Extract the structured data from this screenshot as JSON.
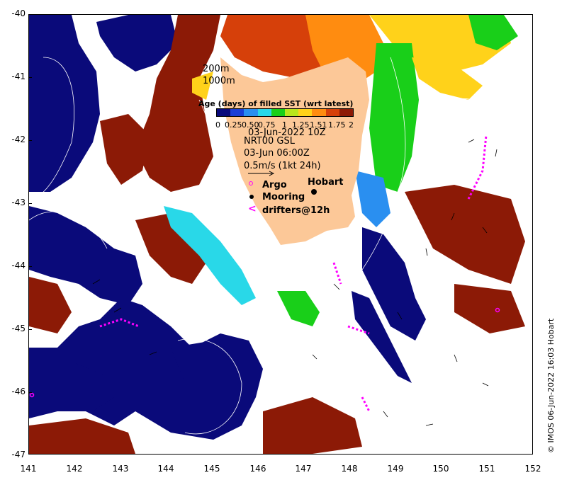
{
  "map": {
    "y_ticks": [
      "-40",
      "-41",
      "-42",
      "-43",
      "-44",
      "-45",
      "-46",
      "-47"
    ],
    "x_ticks": [
      "141",
      "142",
      "143",
      "144",
      "145",
      "146",
      "147",
      "148",
      "149",
      "150",
      "151",
      "152"
    ],
    "lon_range": [
      141,
      152
    ],
    "lat_range": [
      -47,
      -40
    ],
    "depth_labels": [
      "200m",
      "1000m"
    ],
    "colorbar": {
      "title": "Age (days) of filled SST (wrt latest)",
      "ticks": [
        "0",
        "0.25",
        "0.50",
        "0.75",
        "1",
        "1.25",
        "1.51",
        "1.75",
        "2"
      ],
      "colors": [
        "#0a0a7a",
        "#1a3fd6",
        "#2a8ff0",
        "#29d8e8",
        "#19cf19",
        "#b8e61c",
        "#ffd21a",
        "#ff8c10",
        "#d6400a",
        "#8c1a06"
      ]
    },
    "date_label": "03-Jun-2022 10Z",
    "current_source": "NRT00 GSL",
    "current_time": "03-Jun 06:00Z",
    "arrow_scale": "0.5m/s (1kt 24h)",
    "city_label": "Hobart",
    "legend": {
      "argo": "Argo",
      "mooring": "Mooring",
      "drifters": "drifters@12h"
    },
    "credit": "© IMOS 06-Jun-2022 16:03 Hobart",
    "colors": {
      "land": "#fcc898",
      "old_sst": "#0a0a7a",
      "recent_sst": "#8c1a06",
      "markers": "#ff00ff"
    }
  }
}
